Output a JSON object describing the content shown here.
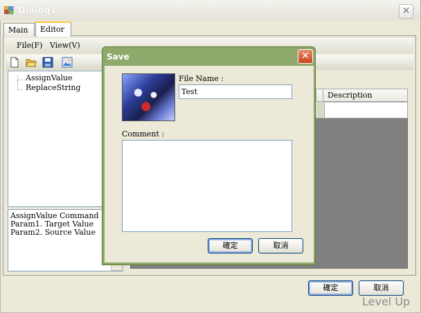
{
  "window": {
    "title": "Dialog1",
    "close_glyph": "✕",
    "icon": "app-form-icon"
  },
  "tabs": [
    {
      "label": "Main",
      "active": false
    },
    {
      "label": "Editor",
      "active": true
    }
  ],
  "menu": [
    {
      "label": "File(F)"
    },
    {
      "label": "View(V)"
    }
  ],
  "toolbar": [
    {
      "icon": "new-file-icon"
    },
    {
      "icon": "open-folder-icon"
    },
    {
      "icon": "save-icon"
    },
    {
      "icon": "image-icon"
    }
  ],
  "tree": {
    "items": [
      {
        "label": "AssignValue"
      },
      {
        "label": "ReplaceString"
      }
    ]
  },
  "info": {
    "lines": [
      "AssignValue Command",
      "",
      "Param1. Target Value",
      "Param2. Source Value"
    ]
  },
  "grid": {
    "columns": [
      {
        "label": "Description"
      }
    ]
  },
  "buttons": {
    "ok": "確定",
    "cancel": "取消"
  },
  "watermark": "Level Up",
  "save_dialog": {
    "title": "Save",
    "close_glyph": "✕",
    "file_name_label": "File Name :",
    "file_name_value": "Test",
    "comment_label": "Comment :",
    "comment_value": "",
    "ok": "確定",
    "cancel": "取消"
  },
  "colors": {
    "dialog_frame": "#8ea96b",
    "window_bg": "#ece9d8",
    "grid_bg": "#808080",
    "tab_highlight": "#ffc83c"
  }
}
